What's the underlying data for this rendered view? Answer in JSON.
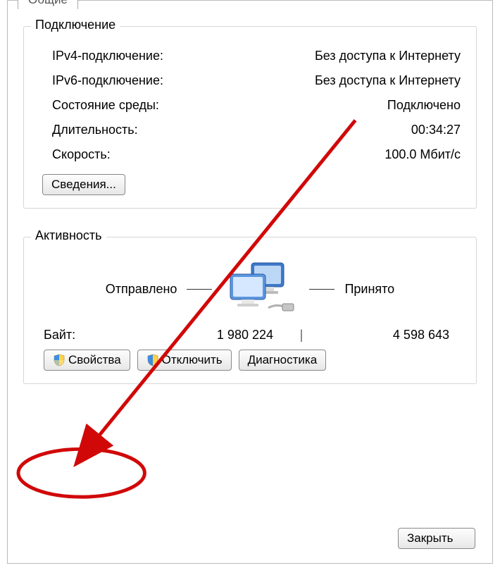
{
  "tab": "Общие",
  "connection": {
    "title": "Подключение",
    "ipv4_label": "IPv4-подключение:",
    "ipv4_value": "Без доступа к Интернету",
    "ipv6_label": "IPv6-подключение:",
    "ipv6_value": "Без доступа к Интернету",
    "media_label": "Состояние среды:",
    "media_value": "Подключено",
    "duration_label": "Длительность:",
    "duration_value": "00:34:27",
    "speed_label": "Скорость:",
    "speed_value": "100.0 Мбит/с",
    "details_button": "Сведения..."
  },
  "activity": {
    "title": "Активность",
    "sent_label": "Отправлено",
    "received_label": "Принято",
    "bytes_label": "Байт:",
    "sent_bytes": "1 980 224",
    "received_bytes": "4 598 643"
  },
  "buttons": {
    "properties": "Свойства",
    "disable": "Отключить",
    "diagnose": "Диагностика",
    "close": "Закрыть"
  }
}
